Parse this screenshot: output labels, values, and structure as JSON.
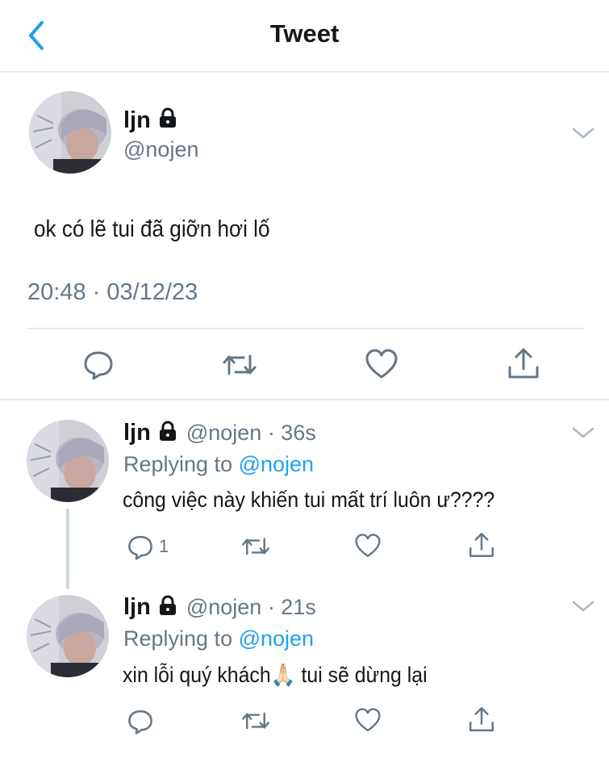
{
  "header": {
    "title": "Tweet"
  },
  "tweet": {
    "name": "ljn",
    "handle": "@nojen",
    "text": "ok có lẽ tui đã giỡn hơi lố",
    "timestamp": "20:48 · 03/12/23"
  },
  "replies": [
    {
      "name": "ljn",
      "meta": "@nojen · 36s",
      "replying_prefix": "Replying to ",
      "replying_handle": "@nojen",
      "text": "công việc này khiến tui mất trí luôn ư????",
      "reply_count": "1"
    },
    {
      "name": "ljn",
      "meta": "@nojen · 21s",
      "replying_prefix": "Replying to ",
      "replying_handle": "@nojen",
      "text_before": "xin lỗi quý khách",
      "emoji": "🙏🏻",
      "text_after": " tui sẽ dừng lại"
    }
  ],
  "colors": {
    "accent": "#1da1f2",
    "icon": "#657786",
    "divider": "#e6ecf0"
  },
  "icons": [
    "chevron-left-icon",
    "lock-icon",
    "chevron-down-icon",
    "reply-icon",
    "retweet-icon",
    "like-icon",
    "share-icon"
  ]
}
